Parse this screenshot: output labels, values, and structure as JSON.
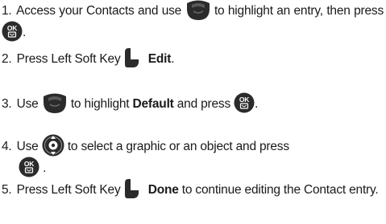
{
  "steps": [
    {
      "num": "1.",
      "t1": "Access your Contacts and use",
      "t2": "to highlight an entry, then press",
      "t3": ".",
      "icons": [
        "navigation-key-icon",
        "ok-key-icon"
      ]
    },
    {
      "num": "2.",
      "t1": "Press Left Soft Key",
      "bold": "Edit",
      "t2": ".",
      "icons": [
        "left-soft-key-icon"
      ]
    },
    {
      "num": "3.",
      "t1": "Use",
      "t2": "to highlight",
      "bold": "Default",
      "t3": "and press",
      "t4": ".",
      "icons": [
        "navigation-key-icon",
        "ok-key-icon"
      ]
    },
    {
      "num": "4.",
      "t1": "Use",
      "t2": "to select a graphic or an object and press",
      "t3": ".",
      "icons": [
        "directional-key-icon",
        "ok-key-icon"
      ]
    },
    {
      "num": "5.",
      "t1": "Press Left Soft Key",
      "bold": "Done",
      "t2": "to continue editing the Contact entry.",
      "icons": [
        "left-soft-key-icon"
      ]
    }
  ],
  "ok_key_text": "OK",
  "colors": {
    "text": "#1a1a1a",
    "key_dark": "#2b2b2b",
    "key_light": "#ffffff"
  }
}
